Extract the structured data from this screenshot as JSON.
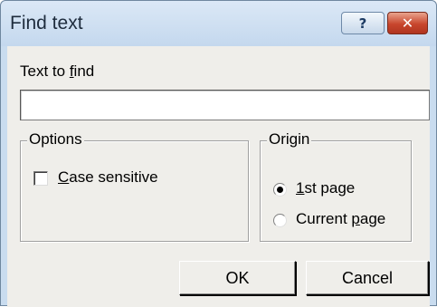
{
  "window": {
    "title": "Find text",
    "help_label": "?",
    "close_label": "✕"
  },
  "find": {
    "label_prefix": "Text to ",
    "label_accel": "f",
    "label_suffix": "ind",
    "value": "",
    "placeholder": ""
  },
  "options": {
    "legend": "Options",
    "case_sensitive": {
      "accel": "C",
      "rest": "ase sensitive",
      "checked": false
    }
  },
  "origin": {
    "legend": "Origin",
    "first_page": {
      "accel": "1",
      "rest": "st page",
      "selected": true
    },
    "current_page": {
      "prefix": "Current ",
      "accel": "p",
      "rest": "age",
      "selected": false
    }
  },
  "buttons": {
    "ok": "OK",
    "cancel": "Cancel"
  },
  "colors": {
    "frame": "#c9dcef",
    "client": "#efeeea",
    "close_button": "#c8462d"
  }
}
